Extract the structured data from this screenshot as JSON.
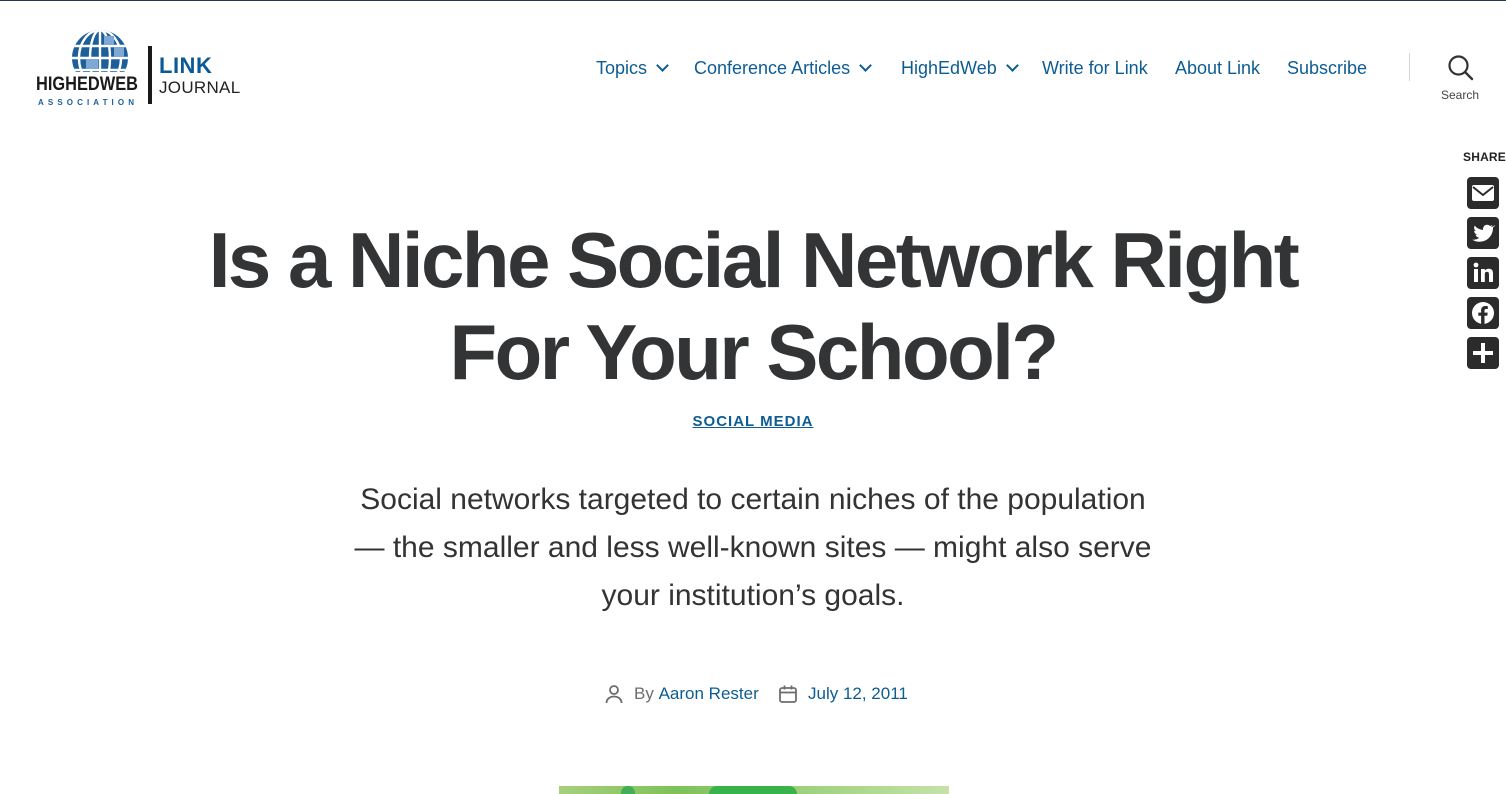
{
  "site": {
    "logo_primary": "HIGHEDWEB",
    "logo_secondary": "ASSOCIATION",
    "logo_link": "LINK",
    "logo_journal": "JOURNAL"
  },
  "nav": {
    "items": [
      {
        "label": "Topics",
        "has_dropdown": true
      },
      {
        "label": "Conference Articles",
        "has_dropdown": true
      },
      {
        "label": "HighEdWeb",
        "has_dropdown": true
      },
      {
        "label": "Write for Link",
        "has_dropdown": false
      },
      {
        "label": "About Link",
        "has_dropdown": false
      },
      {
        "label": "Subscribe",
        "has_dropdown": false
      }
    ],
    "search_label": "Search"
  },
  "share": {
    "title": "SHARE",
    "buttons": [
      "Email",
      "Twitter",
      "LinkedIn",
      "Facebook",
      "Share"
    ]
  },
  "article": {
    "title": "Is a Niche Social Network Right For Your School?",
    "category": "SOCIAL MEDIA",
    "excerpt": "Social networks targeted to certain niches of the population — the smaller and less well-known sites — might also serve your institution’s goals.",
    "author_prefix": "By",
    "author": "Aaron Rester",
    "date": "July 12, 2011"
  },
  "colors": {
    "link": "#0d5d93",
    "title": "#333436",
    "share_button": "#2b2b2b",
    "logo_blue": "#0a5a96"
  }
}
